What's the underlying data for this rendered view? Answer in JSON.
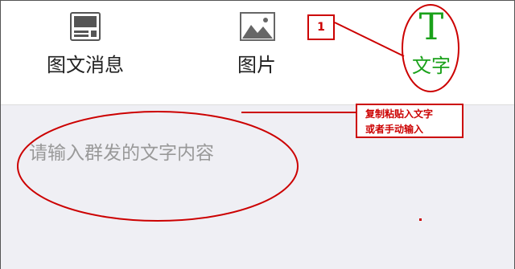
{
  "tabs": [
    {
      "label": "图文消息",
      "icon": "news-card-icon"
    },
    {
      "label": "图片",
      "icon": "image-icon"
    },
    {
      "label": "文字",
      "icon": "text-T-icon",
      "glyph": "T",
      "active_color": "#1aa11a"
    }
  ],
  "editor": {
    "placeholder": "请输入群发的文字内容"
  },
  "annotations": {
    "step_number": "1",
    "note_line1": "复制粘贴入文字",
    "note_line2": "或者手动输入",
    "color": "#cc0000"
  }
}
